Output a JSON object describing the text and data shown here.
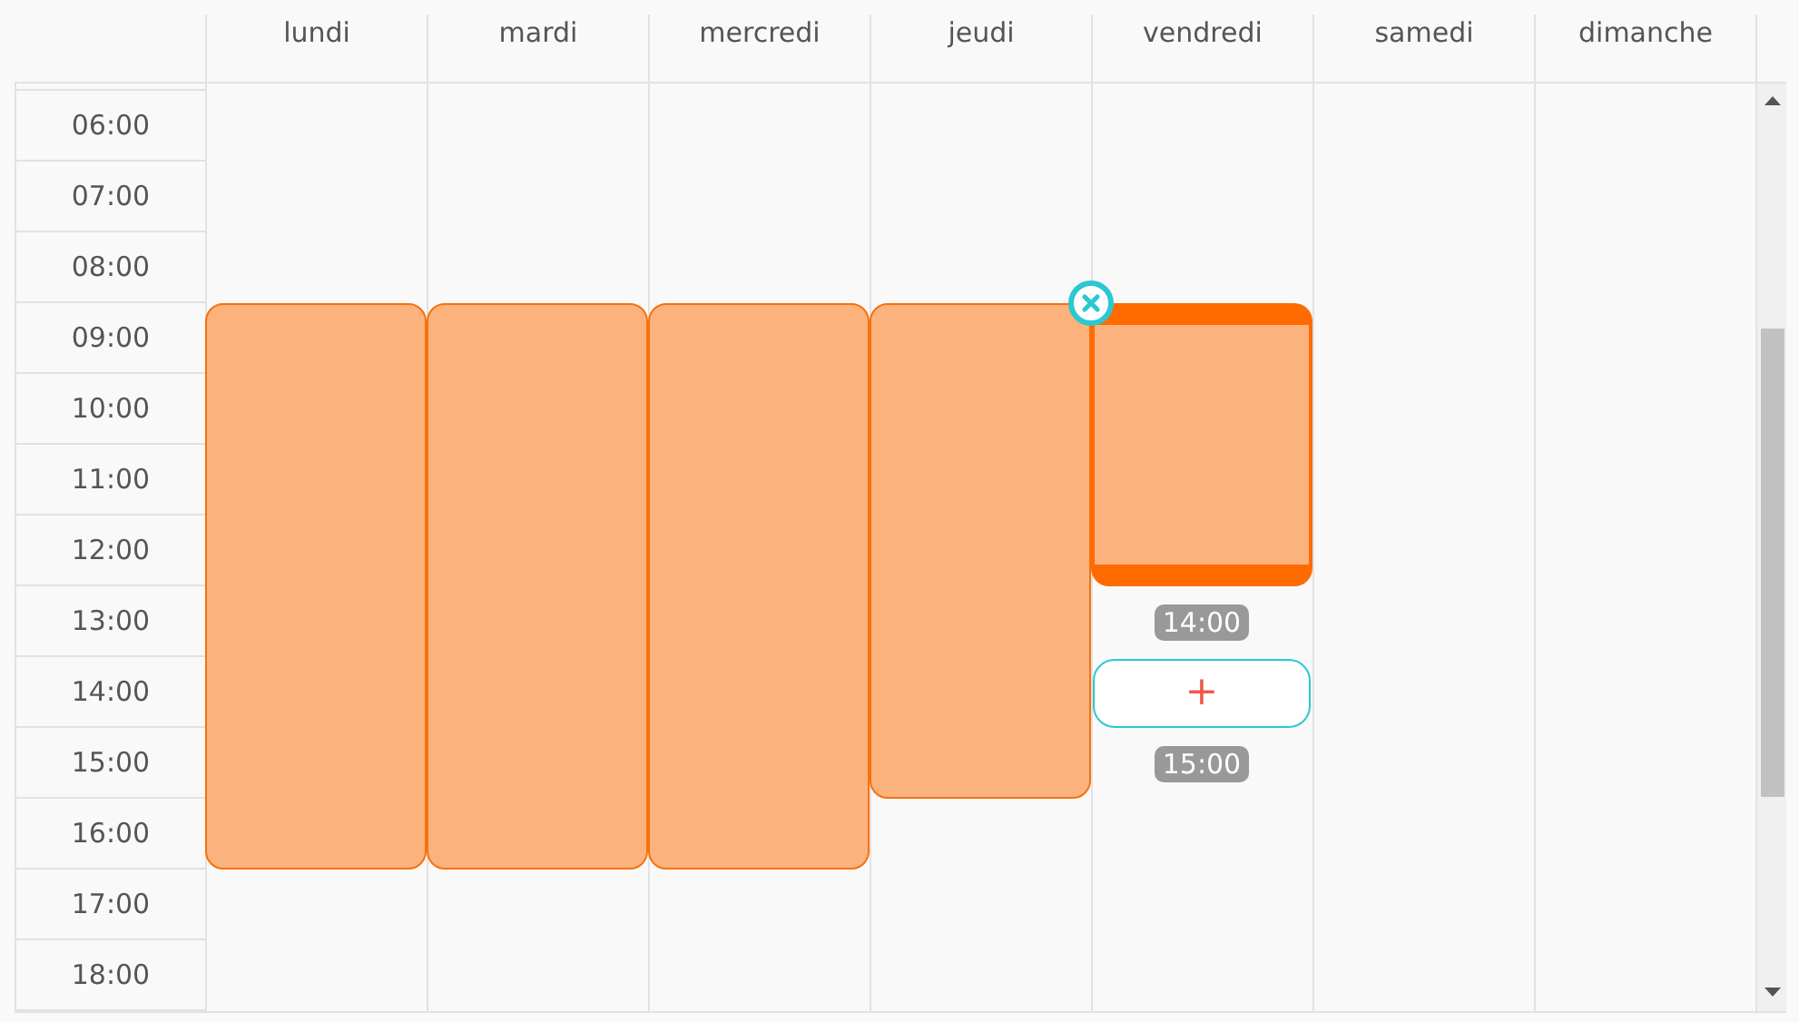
{
  "days": [
    {
      "name": "lundi",
      "event": {
        "selected": false
      }
    },
    {
      "name": "mardi",
      "event": {
        "selected": false
      }
    },
    {
      "name": "mercredi",
      "event": {
        "selected": false
      }
    },
    {
      "name": "jeudi",
      "event": {
        "selected": false
      }
    },
    {
      "name": "vendredi",
      "event": {
        "selected": true
      },
      "new_slot": {
        "start_label": "14:00",
        "add_button": "+",
        "end_label": "15:00"
      }
    },
    {
      "name": "samedi"
    },
    {
      "name": "dimanche"
    }
  ],
  "times": [
    "06:00",
    "07:00",
    "08:00",
    "09:00",
    "10:00",
    "11:00",
    "12:00",
    "13:00",
    "14:00",
    "15:00",
    "16:00",
    "17:00",
    "18:00"
  ]
}
